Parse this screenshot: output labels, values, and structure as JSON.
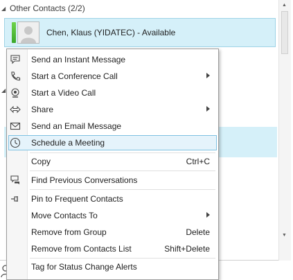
{
  "group": {
    "label": "Other Contacts (2/2)"
  },
  "contact": {
    "name": "Chen, Klaus (YIDATEC) - Available"
  },
  "menu": {
    "items": [
      {
        "label": "Send an Instant Message",
        "shortcut": "",
        "submenu": false,
        "icon": "im-icon"
      },
      {
        "label": "Start a Conference Call",
        "shortcut": "",
        "submenu": true,
        "icon": "phone-icon"
      },
      {
        "label": "Start a Video Call",
        "shortcut": "",
        "submenu": false,
        "icon": "webcam-icon"
      },
      {
        "label": "Share",
        "shortcut": "",
        "submenu": true,
        "icon": "share-icon"
      },
      {
        "label": "Send an Email Message",
        "shortcut": "",
        "submenu": false,
        "icon": "email-icon"
      },
      {
        "label": "Schedule a Meeting",
        "shortcut": "",
        "submenu": false,
        "icon": "meeting-icon",
        "highlighted": true
      },
      {
        "label": "Copy",
        "shortcut": "Ctrl+C",
        "submenu": false,
        "icon": ""
      },
      {
        "label": "Find Previous Conversations",
        "shortcut": "",
        "submenu": false,
        "icon": "conversation-history-icon"
      },
      {
        "label": "Pin to Frequent Contacts",
        "shortcut": "",
        "submenu": false,
        "icon": "pin-icon"
      },
      {
        "label": "Move Contacts To",
        "shortcut": "",
        "submenu": true,
        "icon": ""
      },
      {
        "label": "Remove from Group",
        "shortcut": "Delete",
        "submenu": false,
        "icon": ""
      },
      {
        "label": "Remove from Contacts List",
        "shortcut": "Shift+Delete",
        "submenu": false,
        "icon": ""
      },
      {
        "label": "Tag for Status Change Alerts",
        "shortcut": "",
        "submenu": false,
        "icon": ""
      }
    ]
  },
  "colors": {
    "highlight": "#e5f3fb",
    "highlight_border": "#7ec1e2",
    "selection_bg": "#d5f0f9",
    "presence_available": "#5cc63a"
  }
}
